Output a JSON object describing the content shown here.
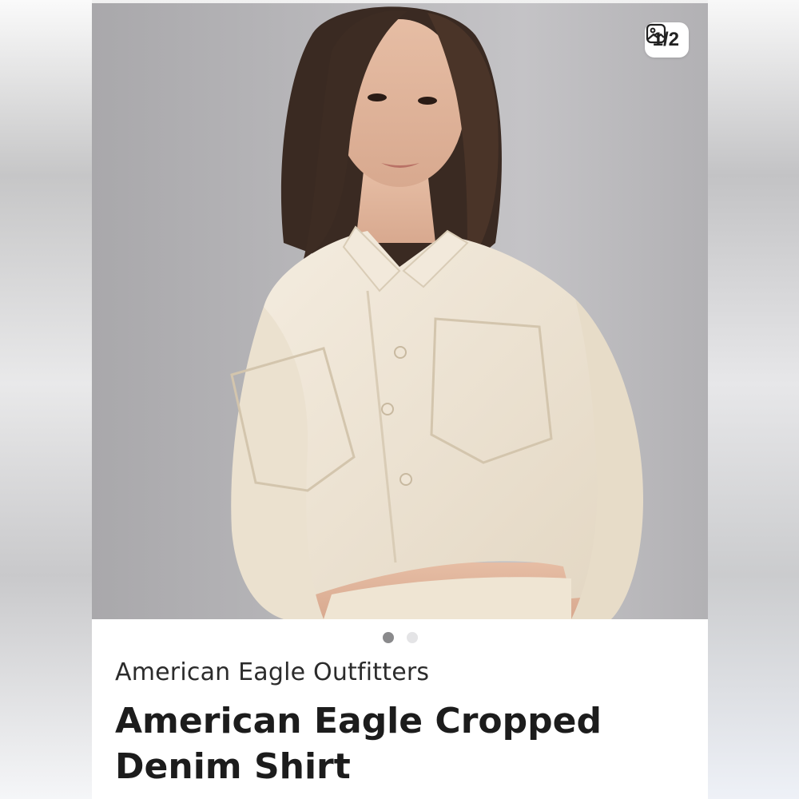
{
  "image": {
    "counter": "1/2",
    "counter_icon": "image-gallery-icon",
    "total": 2,
    "active_index": 0
  },
  "listing": {
    "brand": "American Eagle Outfitters",
    "title": "American Eagle Cropped Denim Shirt"
  },
  "colors": {
    "dot_active": "#8a8a8c",
    "dot_inactive": "#e4e4e6",
    "shirt": "#efe6d6"
  }
}
